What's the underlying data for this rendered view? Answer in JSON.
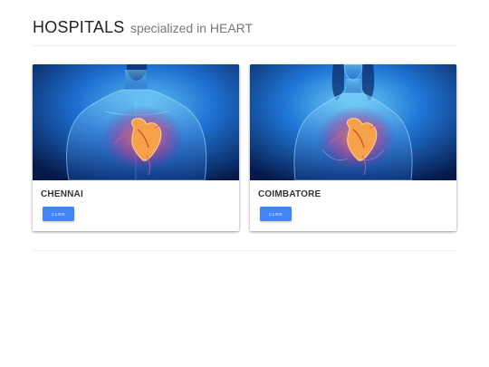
{
  "header": {
    "title": "HOSPITALS",
    "subtitle": "specialized in HEART"
  },
  "cards": [
    {
      "title": "CHENNAI",
      "button_label": "CLICK",
      "image_icon": "heart-anatomy-male-image"
    },
    {
      "title": "COIMBATORE",
      "button_label": "CLICK",
      "image_icon": "heart-anatomy-female-image"
    }
  ],
  "colors": {
    "button": "#4285f4",
    "image_background": "#0b2a6b"
  }
}
